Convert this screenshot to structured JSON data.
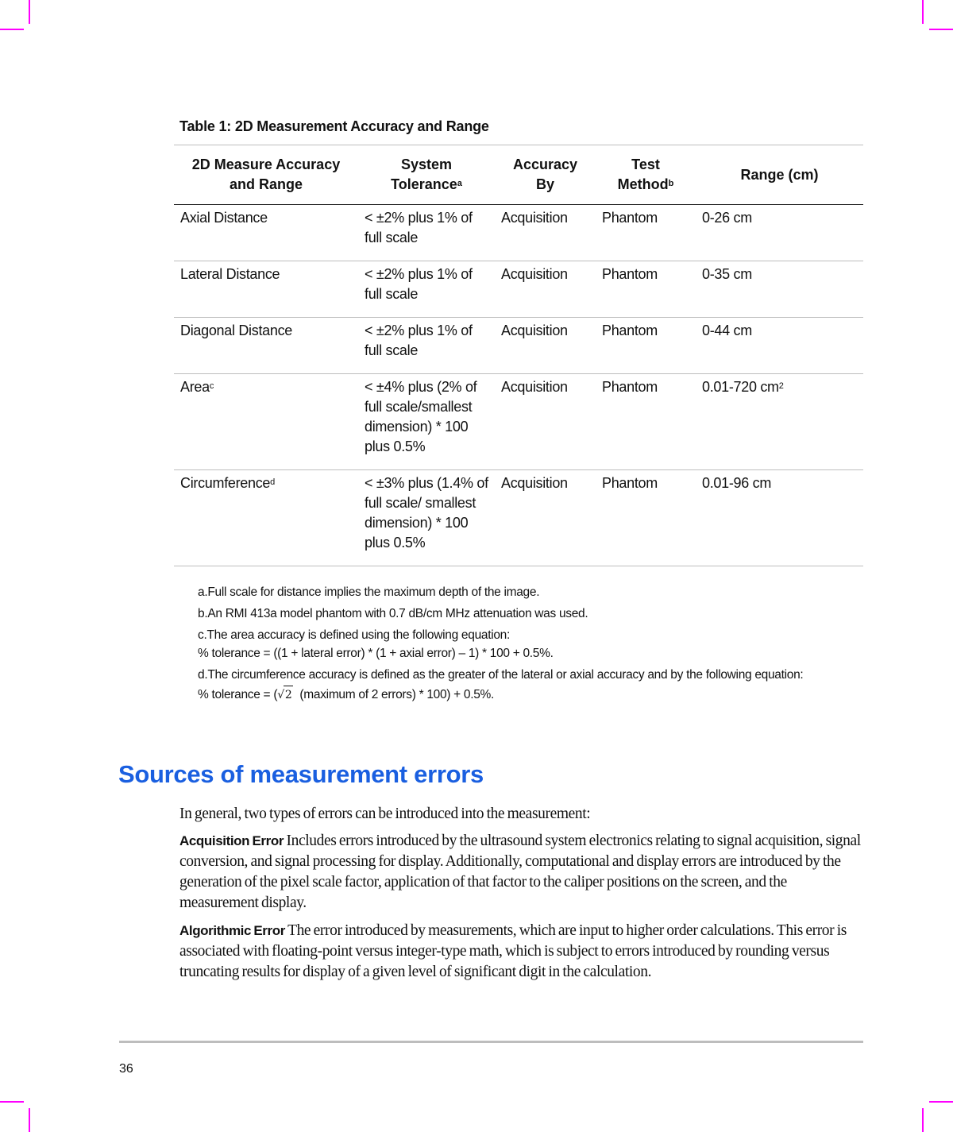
{
  "table": {
    "title": "Table 1: 2D Measurement Accuracy and Range",
    "headers": [
      {
        "line1": "2D Measure Accuracy",
        "line2": "and Range",
        "sup": ""
      },
      {
        "line1": "System",
        "line2": "Tolerance",
        "sup": "a"
      },
      {
        "line1": "Accuracy",
        "line2": "By",
        "sup": ""
      },
      {
        "line1": "Test",
        "line2": "Method",
        "sup": "b"
      },
      {
        "line1": "Range (cm)",
        "line2": "",
        "sup": ""
      }
    ],
    "rows": [
      {
        "measure": "Axial Distance",
        "measure_sup": "",
        "tolerance": "< ±2% plus 1% of full scale",
        "accuracy_by": "Acquisition",
        "test_method": "Phantom",
        "range": "0-26 cm",
        "range_sup": ""
      },
      {
        "measure": "Lateral Distance",
        "measure_sup": "",
        "tolerance": "< ±2% plus 1% of full scale",
        "accuracy_by": "Acquisition",
        "test_method": "Phantom",
        "range": "0-35 cm",
        "range_sup": ""
      },
      {
        "measure": "Diagonal Distance",
        "measure_sup": "",
        "tolerance": "< ±2% plus 1% of full scale",
        "accuracy_by": "Acquisition",
        "test_method": "Phantom",
        "range": "0-44 cm",
        "range_sup": ""
      },
      {
        "measure": "Area",
        "measure_sup": "c",
        "tolerance": "< ±4% plus (2% of full scale/smallest dimension) * 100 plus 0.5%",
        "accuracy_by": "Acquisition",
        "test_method": "Phantom",
        "range": "0.01-720 cm",
        "range_sup": "2"
      },
      {
        "measure": "Circumference",
        "measure_sup": "d",
        "tolerance": "< ±3% plus (1.4% of full scale/ smallest dimension) * 100 plus 0.5%",
        "accuracy_by": "Acquisition",
        "test_method": "Phantom",
        "range": "0.01-96 cm",
        "range_sup": ""
      }
    ]
  },
  "footnotes": {
    "a": "a.Full scale for distance implies the maximum depth of the image.",
    "b": "b.An RMI 413a model phantom with 0.7 dB/cm MHz attenuation was used.",
    "c_line1": "c.The area accuracy is defined using the following equation:",
    "c_line2": "% tolerance = ((1 + lateral error) * (1 + axial error) – 1) * 100 + 0.5%.",
    "d_line1": "d.The circumference accuracy is defined as the greater of the lateral or axial accuracy and by the following equation:",
    "d_eq_prefix": "% tolerance = (",
    "d_eq_radicand": "2",
    "d_eq_suffix": "  (maximum of 2 errors) * 100) + 0.5%."
  },
  "section": {
    "heading": "Sources of measurement errors",
    "heading_color": "#1a5fe0",
    "intro": "In general, two types of errors can be introduced into the measurement:",
    "items": [
      {
        "term": "Acquisition Error",
        "text": " Includes errors introduced by the ultrasound system electronics relating to signal acquisition, signal conversion, and signal processing for display. Additionally, computational and display errors are introduced by the generation of the pixel scale factor, application of that factor to the caliper positions on the screen, and the measurement display."
      },
      {
        "term": "Algorithmic Error",
        "text": " The error introduced by measurements, which are input to higher order calculations. This error is associated with floating-point versus integer-type math, which is subject to errors introduced by rounding versus truncating results for display of a given level of significant digit in the calculation."
      }
    ]
  },
  "footer": {
    "page_number": "36"
  }
}
